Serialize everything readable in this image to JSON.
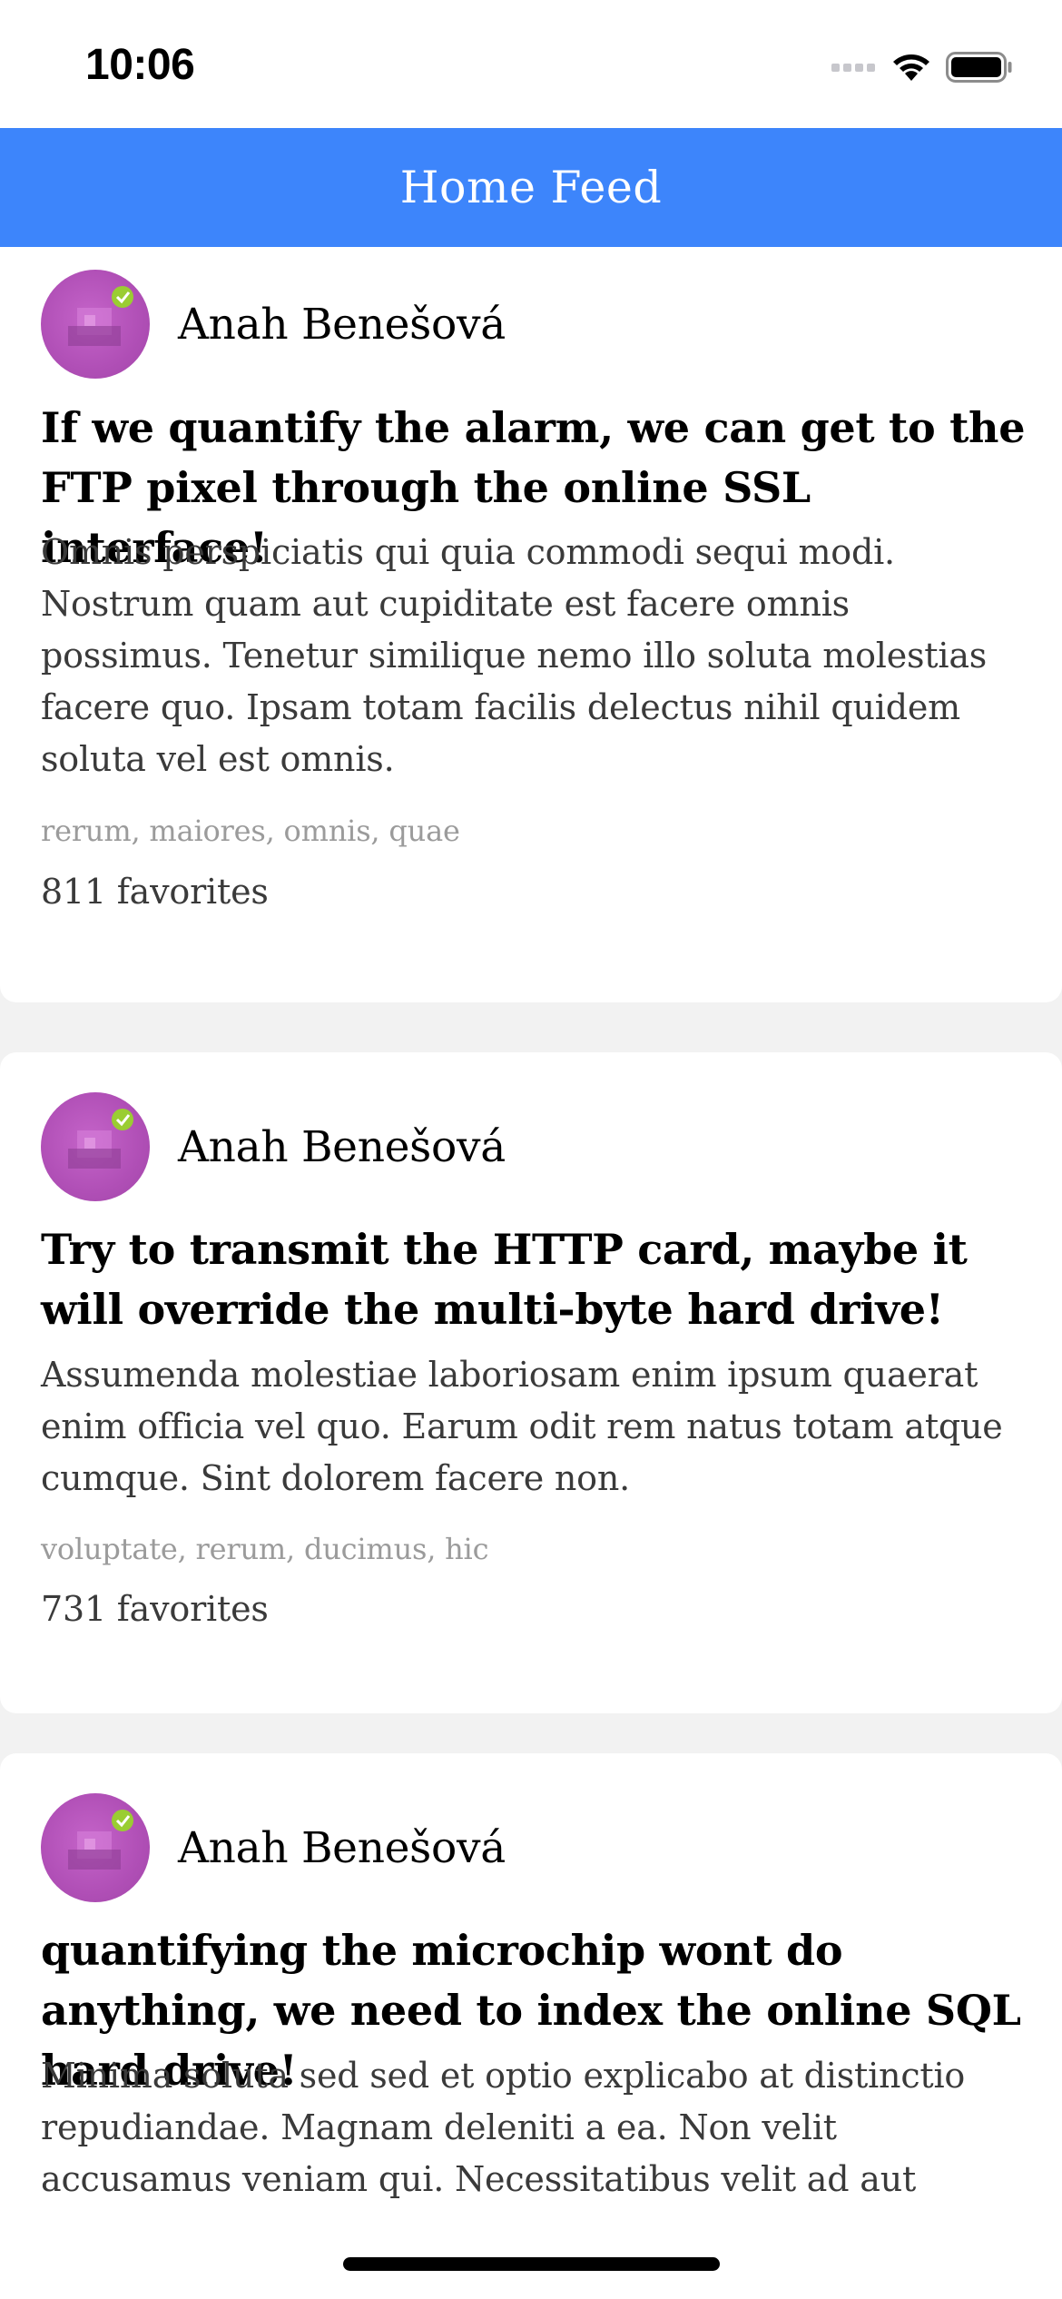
{
  "status_bar": {
    "time": "10:06"
  },
  "header": {
    "title": "Home Feed"
  },
  "posts": [
    {
      "author": "Anah Benešová",
      "title": "If we quantify the alarm, we can get to the FTP pixel through the online SSL interface!",
      "body": "Omnis perspiciatis qui quia commodi sequi modi. Nostrum quam aut cupiditate est facere omnis possimus. Tenetur similique nemo illo soluta molestias facere quo. Ipsam totam facilis delectus nihil quidem soluta vel est omnis.",
      "tags": "rerum, maiores, omnis, quae",
      "favorites": "811 favorites"
    },
    {
      "author": "Anah Benešová",
      "title": "Try to transmit the HTTP card, maybe it will override the multi-byte hard drive!",
      "body": "Assumenda molestiae laboriosam enim ipsum quaerat enim officia vel quo. Earum odit rem natus totam atque cumque. Sint dolorem facere non.",
      "tags": "voluptate, rerum, ducimus, hic",
      "favorites": "731 favorites"
    },
    {
      "author": "Anah Benešová",
      "title": "quantifying the microchip wont do anything, we need to index the online SQL hard drive!",
      "body": "Minima soluta sed sed et optio explicabo at distinctio repudiandae. Magnam deleniti a ea. Non velit accusamus veniam qui. Necessitatibus velit ad aut officiis in officiis"
    }
  ],
  "icons": {
    "signal": "cellular-signal-icon",
    "wifi": "wifi-icon",
    "battery": "battery-icon",
    "avatar": "avatar-image"
  },
  "colors": {
    "header_background": "#3d85fb",
    "header_text": "#ffffff",
    "page_background": "#f2f2f2",
    "tag_text": "#9b9b9b",
    "body_text": "#3a3a3a",
    "avatar": "#b04fb6"
  }
}
